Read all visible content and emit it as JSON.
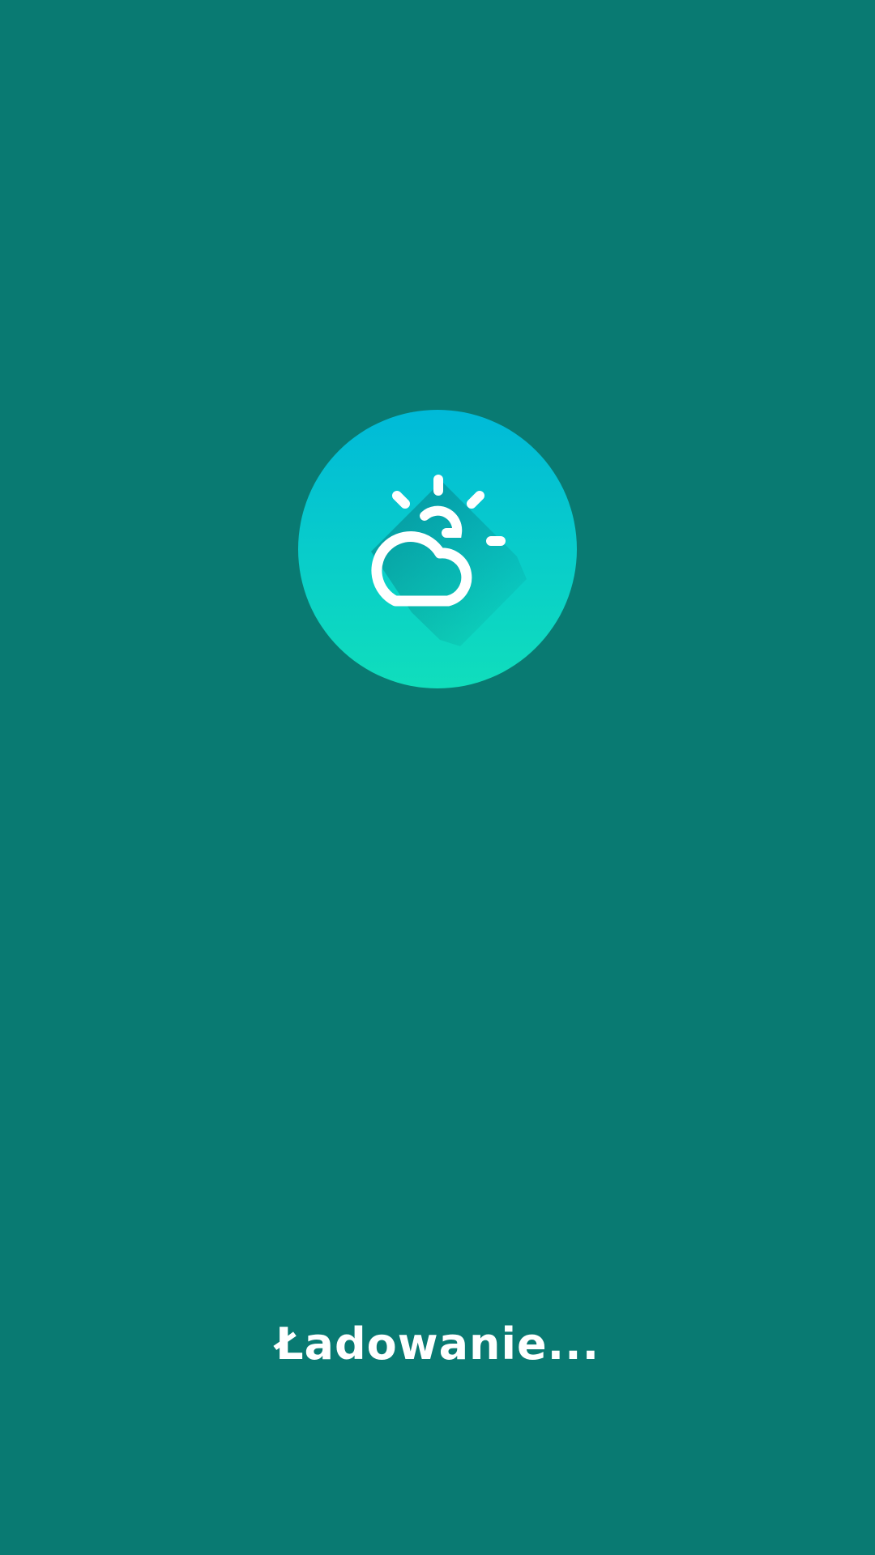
{
  "app": {
    "loading_text": "Ładowanie...",
    "logo_icon": "partly-cloudy-weather-icon"
  },
  "colors": {
    "background": "#097a72",
    "logo_gradient_top": "#00bcd8",
    "logo_gradient_bottom": "#10dfbd",
    "icon_stroke": "#ffffff"
  }
}
